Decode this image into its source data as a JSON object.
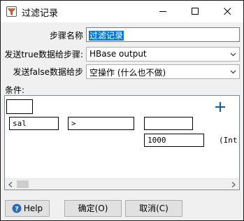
{
  "window": {
    "title": "过滤记录"
  },
  "form": {
    "step_name_label": "步骤名称",
    "step_name_value": "过滤记录",
    "send_true_label": "发送true数据给步骤:",
    "send_true_value": "HBase output",
    "send_false_label": "发送false数据给步",
    "send_false_value": "空操作 (什么也不做)"
  },
  "condition": {
    "label": "条件:",
    "negate_value": "",
    "field": "sal",
    "operator": ">",
    "second_value": "",
    "value": "1000",
    "value_type": "(Int"
  },
  "buttons": {
    "help": "Help",
    "ok": "确定(O)",
    "cancel": "取消(C)"
  },
  "colors": {
    "accent_plus": "#1f5fa0",
    "selection": "#0078d7"
  }
}
